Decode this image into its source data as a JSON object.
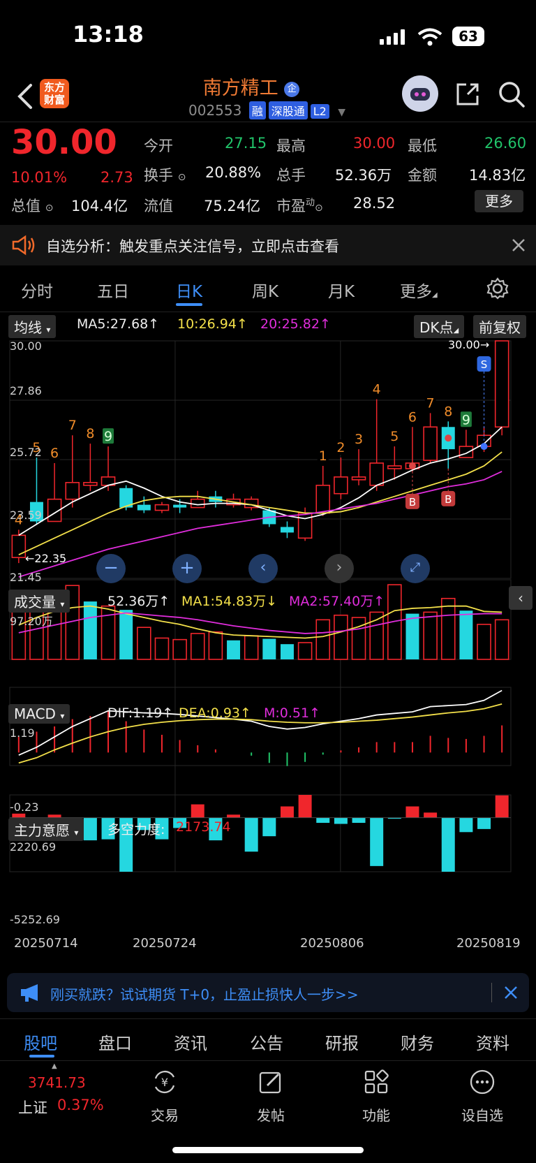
{
  "status_bar": {
    "time": "13:18",
    "battery": "63"
  },
  "header": {
    "logo_line1": "东方",
    "logo_line2": "财富",
    "stock_name": "南方精工",
    "enterprise_badge": "企",
    "stock_code": "002553",
    "tags": [
      "融",
      "深股通",
      "L2"
    ]
  },
  "quote": {
    "price": "30.00",
    "change_pct": "10.01%",
    "change": "2.73",
    "open_label": "今开",
    "open": "27.15",
    "high_label": "最高",
    "high": "30.00",
    "low_label": "最低",
    "low": "26.60",
    "turnover_label": "换手",
    "turnover": "20.88%",
    "volume_label": "总手",
    "volume": "52.36万",
    "amount_label": "金额",
    "amount": "14.83亿",
    "mktcap_label": "总值",
    "mktcap": "104.4亿",
    "float_label": "流值",
    "float": "75.24亿",
    "pe_label": "市盈",
    "pe_sup": "动",
    "pe": "28.52",
    "more_label": "更多"
  },
  "alert": {
    "text": "自选分析：触发重点关注信号，立即点击查看"
  },
  "period_tabs": [
    {
      "label": "分时"
    },
    {
      "label": "五日"
    },
    {
      "label": "日K"
    },
    {
      "label": "周K"
    },
    {
      "label": "月K"
    },
    {
      "label": "更多"
    }
  ],
  "ma_bar": {
    "selector": "均线",
    "ma5": "MA5:27.68",
    "ma10": "10:26.94",
    "ma20": "20:25.82",
    "dk_label": "DK点",
    "adjust_label": "前复权"
  },
  "kline_axis": {
    "y_labels": [
      "30.00",
      "27.86",
      "25.72",
      "23.59",
      "21.45"
    ],
    "max_label": "30.00",
    "min_label": "22.35"
  },
  "volume_bar": {
    "selector": "成交量",
    "vol": "52.36万",
    "ma1": "MA1:54.83万",
    "ma2": "MA2:57.40万",
    "top_label": "97.20万"
  },
  "macd_bar": {
    "selector": "MACD",
    "dif": "DIF:1.19",
    "dea": "DEA:0.93",
    "m": "M:0.51",
    "top_label": "1.19",
    "bottom_label": "-0.23"
  },
  "force_bar": {
    "selector": "主力意愿",
    "label": "多空力度:",
    "value": "2173.74",
    "top_label": "2220.69",
    "bottom_label": "-5252.69"
  },
  "x_dates": [
    "20250714",
    "20250724",
    "20250806",
    "20250819"
  ],
  "promo": {
    "text": "刚买就跌？试试期货 T+0，止盈止损快人一步>>"
  },
  "bottom_tabs": [
    {
      "label": "股吧"
    },
    {
      "label": "盘口"
    },
    {
      "label": "资讯"
    },
    {
      "label": "公告"
    },
    {
      "label": "研报"
    },
    {
      "label": "财务"
    },
    {
      "label": "资料"
    }
  ],
  "index": {
    "value": "3741.73",
    "name": "上证",
    "pct": "0.37%"
  },
  "bottom_actions": [
    {
      "label": "交易"
    },
    {
      "label": "发帖"
    },
    {
      "label": "功能"
    },
    {
      "label": "设自选"
    }
  ],
  "colors": {
    "up": "#f0262c",
    "down": "#25d7e0",
    "accent": "#3e8ef7"
  },
  "chart_data": {
    "type": "candlestick",
    "ylim": [
      21.45,
      30.0
    ],
    "candles": [
      {
        "o": 22.2,
        "c": 23.0,
        "h": 23.2,
        "l": 22.0,
        "up": true,
        "sig": "4"
      },
      {
        "o": 24.2,
        "c": 23.5,
        "h": 25.8,
        "l": 23.4,
        "up": false,
        "sig": "5"
      },
      {
        "o": 23.5,
        "c": 24.3,
        "h": 25.6,
        "l": 23.5,
        "up": true,
        "sig": "6"
      },
      {
        "o": 24.3,
        "c": 24.9,
        "h": 26.6,
        "l": 24.0,
        "up": true,
        "sig": "7"
      },
      {
        "o": 24.8,
        "c": 24.9,
        "h": 26.3,
        "l": 24.6,
        "up": true,
        "sig": "8"
      },
      {
        "o": 24.8,
        "c": 25.1,
        "h": 26.2,
        "l": 24.6,
        "up": true,
        "sig": "9"
      },
      {
        "o": 24.7,
        "c": 24.0,
        "h": 24.8,
        "l": 23.9,
        "up": false
      },
      {
        "o": 24.1,
        "c": 23.9,
        "h": 24.4,
        "l": 23.8,
        "up": false
      },
      {
        "o": 23.9,
        "c": 24.1,
        "h": 24.2,
        "l": 23.8,
        "up": true
      },
      {
        "o": 24.1,
        "c": 24.0,
        "h": 24.3,
        "l": 23.8,
        "up": false
      },
      {
        "o": 24.0,
        "c": 24.3,
        "h": 24.6,
        "l": 24.0,
        "up": true
      },
      {
        "o": 24.4,
        "c": 24.2,
        "h": 24.6,
        "l": 24.0,
        "up": false
      },
      {
        "o": 24.1,
        "c": 24.3,
        "h": 24.5,
        "l": 24.0,
        "up": true
      },
      {
        "o": 24.3,
        "c": 24.0,
        "h": 24.4,
        "l": 23.9,
        "up": true
      },
      {
        "o": 23.9,
        "c": 23.4,
        "h": 24.0,
        "l": 23.3,
        "up": false
      },
      {
        "o": 23.3,
        "c": 23.1,
        "h": 23.5,
        "l": 22.9,
        "up": false
      },
      {
        "o": 22.9,
        "c": 23.8,
        "h": 24.0,
        "l": 22.8,
        "up": true
      },
      {
        "o": 23.8,
        "c": 24.8,
        "h": 25.5,
        "l": 23.7,
        "up": true,
        "sig": "1"
      },
      {
        "o": 24.5,
        "c": 25.1,
        "h": 25.8,
        "l": 24.3,
        "up": true,
        "sig": "2"
      },
      {
        "o": 25.0,
        "c": 25.1,
        "h": 26.1,
        "l": 24.8,
        "up": true,
        "sig": "3"
      },
      {
        "o": 24.8,
        "c": 25.6,
        "h": 27.9,
        "l": 24.6,
        "up": true,
        "sig": "4"
      },
      {
        "o": 25.4,
        "c": 25.5,
        "h": 26.2,
        "l": 25.0,
        "up": true,
        "sig": "5"
      },
      {
        "o": 25.4,
        "c": 25.6,
        "h": 26.9,
        "l": 25.3,
        "up": true,
        "sig": "6",
        "buy": true
      },
      {
        "o": 25.7,
        "c": 26.9,
        "h": 27.4,
        "l": 25.6,
        "up": true,
        "sig": "7"
      },
      {
        "o": 26.9,
        "c": 26.1,
        "h": 27.1,
        "l": 25.4,
        "up": false,
        "sig": "8",
        "buy": true
      },
      {
        "o": 25.8,
        "c": 26.2,
        "h": 26.8,
        "l": 25.8,
        "up": true,
        "sig": "9"
      },
      {
        "o": 26.2,
        "c": 26.6,
        "h": 26.9,
        "l": 26.0,
        "up": true
      },
      {
        "o": 26.9,
        "c": 30.0,
        "h": 30.0,
        "l": 26.6,
        "up": true,
        "sell": true
      }
    ],
    "ma5": [
      23.0,
      23.4,
      23.8,
      24.2,
      24.5,
      24.8,
      24.95,
      24.7,
      24.4,
      24.2,
      24.1,
      24.15,
      24.15,
      24.1,
      23.9,
      23.7,
      23.6,
      23.75,
      24.0,
      24.35,
      24.8,
      25.05,
      25.35,
      25.6,
      25.75,
      25.95,
      26.3,
      26.9
    ],
    "ma10": [
      22.3,
      22.6,
      22.9,
      23.2,
      23.5,
      23.8,
      24.05,
      24.25,
      24.35,
      24.4,
      24.4,
      24.3,
      24.2,
      24.1,
      24.0,
      23.9,
      23.8,
      23.8,
      23.85,
      24.0,
      24.2,
      24.4,
      24.6,
      24.8,
      25.0,
      25.2,
      25.5,
      26.0
    ],
    "ma20": [
      21.5,
      21.7,
      21.9,
      22.1,
      22.3,
      22.5,
      22.65,
      22.8,
      22.95,
      23.1,
      23.25,
      23.35,
      23.45,
      23.55,
      23.65,
      23.7,
      23.75,
      23.85,
      23.95,
      24.05,
      24.15,
      24.3,
      24.45,
      24.6,
      24.75,
      24.85,
      25.0,
      25.3
    ],
    "volume": {
      "ylim": [
        0,
        97.2
      ],
      "values": [
        63,
        72,
        88,
        97,
        76,
        70,
        65,
        42,
        28,
        26,
        34,
        36,
        25,
        31,
        27,
        20,
        22,
        52,
        58,
        55,
        62,
        98,
        60,
        62,
        80,
        64,
        46,
        52
      ],
      "up": [
        true,
        true,
        true,
        true,
        false,
        true,
        false,
        true,
        true,
        true,
        true,
        true,
        false,
        true,
        false,
        false,
        true,
        true,
        true,
        true,
        true,
        true,
        false,
        true,
        true,
        false,
        true,
        true
      ],
      "ma1": [
        45,
        55,
        63,
        68,
        70,
        66,
        60,
        55,
        50,
        46,
        40,
        35,
        32,
        31,
        30,
        29,
        28,
        30,
        36,
        43,
        52,
        64,
        67,
        68,
        70,
        70,
        63,
        62
      ],
      "ma2": [
        35,
        40,
        45,
        50,
        55,
        58,
        61,
        59,
        57,
        55,
        52,
        48,
        44,
        41,
        38,
        36,
        34,
        35,
        37,
        40,
        45,
        50,
        54,
        56,
        58,
        59,
        60,
        60
      ]
    },
    "macd": {
      "ylim": [
        -0.25,
        1.25
      ],
      "dif": [
        -0.05,
        0.1,
        0.3,
        0.5,
        0.65,
        0.8,
        0.78,
        0.76,
        0.75,
        0.73,
        0.7,
        0.67,
        0.64,
        0.6,
        0.5,
        0.45,
        0.48,
        0.55,
        0.6,
        0.65,
        0.72,
        0.75,
        0.78,
        0.88,
        0.9,
        0.92,
        1.0,
        1.19
      ],
      "dea": [
        -0.2,
        -0.1,
        0.05,
        0.18,
        0.3,
        0.4,
        0.48,
        0.54,
        0.58,
        0.61,
        0.63,
        0.64,
        0.64,
        0.63,
        0.6,
        0.58,
        0.57,
        0.57,
        0.58,
        0.6,
        0.62,
        0.65,
        0.68,
        0.72,
        0.76,
        0.79,
        0.84,
        0.93
      ],
      "hist": [
        0.3,
        0.4,
        0.5,
        0.64,
        0.7,
        0.8,
        0.6,
        0.44,
        0.34,
        0.24,
        0.14,
        0.06,
        0.0,
        -0.06,
        -0.2,
        -0.26,
        -0.18,
        -0.04,
        0.04,
        0.1,
        0.2,
        0.2,
        0.2,
        0.32,
        0.28,
        0.26,
        0.32,
        0.52
      ]
    },
    "force": {
      "ylim": [
        -5252.69,
        2220.69
      ],
      "values": [
        400,
        -1600,
        300,
        -1300,
        -2200,
        -2100,
        -5252,
        -1200,
        -2100,
        -1000,
        1300,
        -2200,
        300,
        -3300,
        -1800,
        1100,
        2220,
        -500,
        -600,
        -500,
        -4700,
        -100,
        1100,
        500,
        -5252,
        -1400,
        -1100,
        2173
      ]
    }
  }
}
